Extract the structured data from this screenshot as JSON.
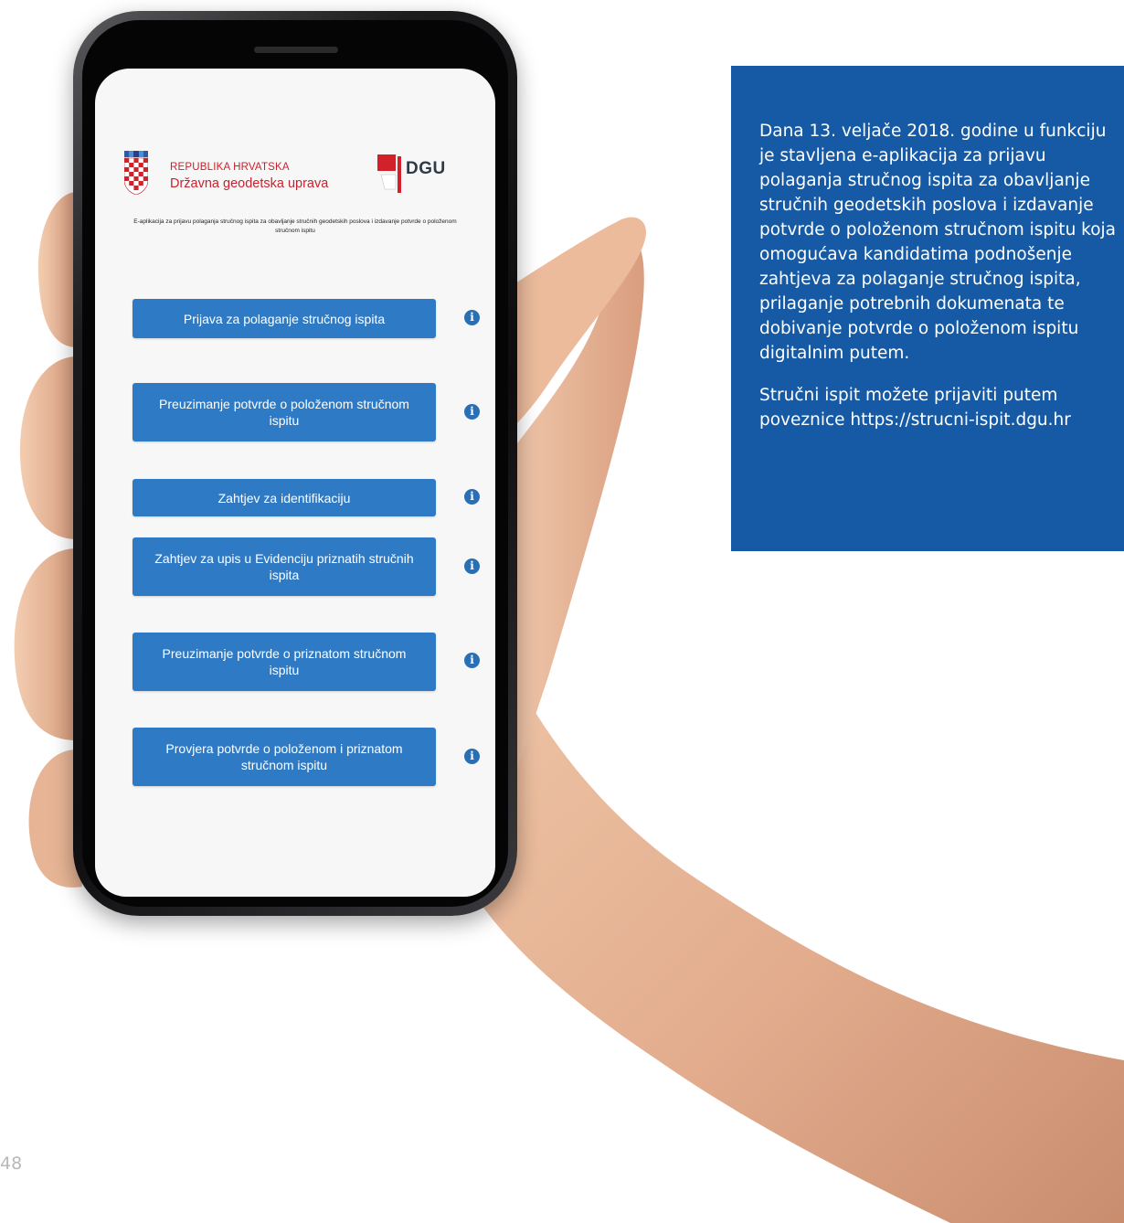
{
  "app": {
    "header": {
      "org_line1": "REPUBLIKA HRVATSKA",
      "org_line2": "Državna geodetska uprava",
      "dgu_logo_text": "DGU"
    },
    "subtitle": "E-aplikacija za prijavu polaganja stručnog ispita za obavljanje stručnih geodetskih poslova i izdavanje potvrde o položenom stručnom ispitu",
    "actions": [
      {
        "label": "Prijava za polaganje stručnog ispita",
        "icon": "info-icon"
      },
      {
        "label": "Preuzimanje potvrde o položenom stručnom ispitu",
        "icon": "info-icon"
      },
      {
        "label": "Zahtjev za identifikaciju",
        "icon": "info-icon"
      },
      {
        "label": "Zahtjev za upis u Evidenciju priznatih stručnih ispita",
        "icon": "info-icon"
      },
      {
        "label": "Preuzimanje potvrde o priznatom stručnom ispitu",
        "icon": "info-icon"
      },
      {
        "label": "Provjera potvrde o položenom i priznatom stručnom ispitu",
        "icon": "info-icon"
      }
    ],
    "info_glyph": "i"
  },
  "info_box": {
    "paragraph1": "Dana 13. veljače 2018. godine u funkciju\nje stavljena e-aplikacija za prijavu\npolaganja stručnog ispita za obavljanje\nstručnih geodetskih poslova i izdavanje\npotvrde o položenom stručnom ispitu koja\nomogućava kandidatima podnošenje\nzahtjeva za polaganje stručnog ispita,\nprilaganje potrebnih dokumenata te\ndobivanje potvrde o položenom ispitu\ndigitalnim putem.",
    "paragraph2": "Stručni ispit možete prijaviti putem\npoveznice https://strucni-ispit.dgu.hr"
  },
  "page_number": "48",
  "colors": {
    "button_blue": "#2f7ac4",
    "box_blue": "#165aa5",
    "header_red": "#c8232c"
  }
}
